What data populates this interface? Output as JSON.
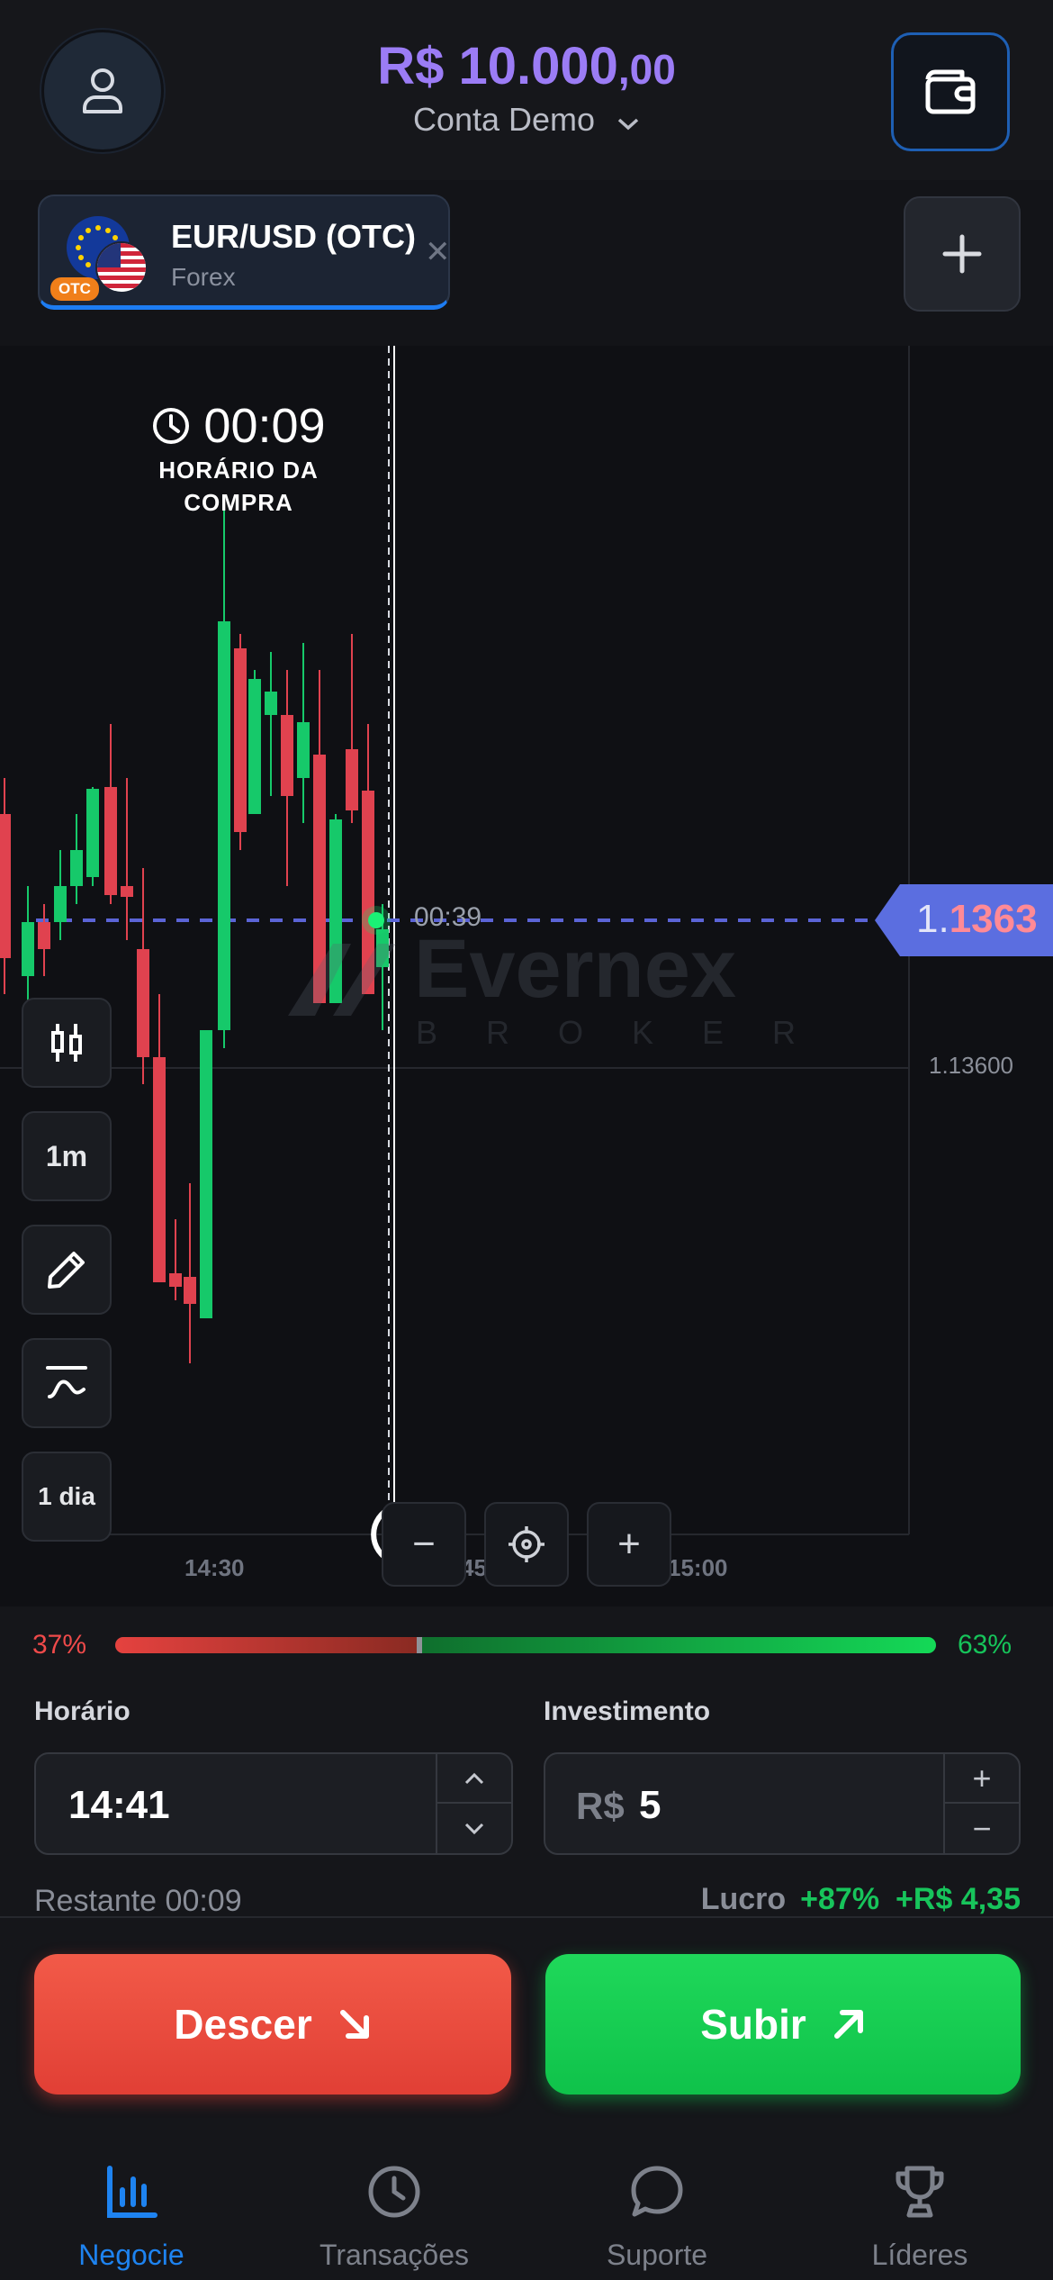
{
  "header": {
    "balance_main": "R$ 10.000",
    "balance_cents": ",00",
    "account_label": "Conta Demo"
  },
  "asset": {
    "name": "EUR/USD (OTC)",
    "type": "Forex",
    "badge": "OTC"
  },
  "chart": {
    "timer_value": "00:09",
    "timer_label_line1": "HORÁRIO DA",
    "timer_label_line2": "COMPRA",
    "countdown": "00:39",
    "current_price_prefix": "1.",
    "current_price_highlight": "1363",
    "price_level_label": "1.13600",
    "time_labels": [
      "14:30",
      "45",
      "15:00"
    ],
    "watermark_title": "Evernex",
    "watermark_subtitle": "BROKER",
    "tools": {
      "timeframe": "1m",
      "range": "1 dia"
    }
  },
  "sentiment": {
    "down_label": "37%",
    "up_label": "63%",
    "down_fraction": 0.37,
    "up_fraction": 0.63
  },
  "trade": {
    "time_label": "Horário",
    "time_value": "14:41",
    "investment_label": "Investimento",
    "investment_currency": "R$",
    "investment_value": "5",
    "remaining": "Restante 00:09",
    "profit_label": "Lucro",
    "profit_percent": "+87%",
    "profit_amount": "+R$ 4,35",
    "down_button": "Descer",
    "up_button": "Subir"
  },
  "nav": {
    "items": [
      {
        "label": "Negocie",
        "icon": "bar-chart-icon",
        "active": true
      },
      {
        "label": "Transações",
        "icon": "clock-icon",
        "active": false
      },
      {
        "label": "Suporte",
        "icon": "chat-bubble-icon",
        "active": false
      },
      {
        "label": "Líderes",
        "icon": "trophy-icon",
        "active": false
      }
    ]
  },
  "colors": {
    "accent": "#9b7cf5",
    "up": "#14d957",
    "down": "#e5423f",
    "active_nav": "#1e83f0"
  }
}
